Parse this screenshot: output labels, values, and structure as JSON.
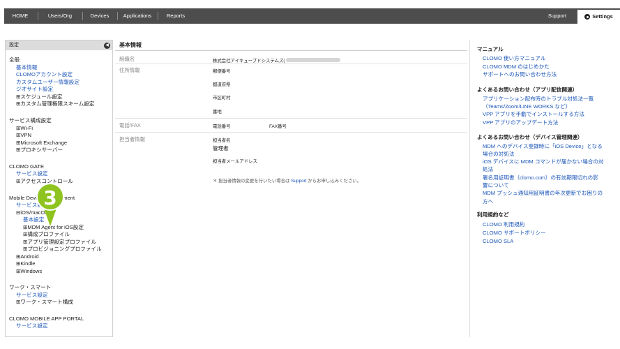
{
  "nav": {
    "items": [
      "HOME",
      "Users/Org",
      "Devices",
      "Applications",
      "Reports"
    ],
    "support": "Support",
    "settings": "Settings"
  },
  "sidebar": {
    "header": "設定",
    "collapse_icon": "chevron-left-icon",
    "lines": [
      {
        "text": "全般",
        "kind": "h"
      },
      {
        "text": "基本情報",
        "kind": "link"
      },
      {
        "text": "CLOMOアカウント設定",
        "kind": "link"
      },
      {
        "text": "カスタムユーザー情報設定",
        "kind": "link"
      },
      {
        "text": "ジオサイト設定",
        "kind": "link"
      },
      {
        "text": "⊞スケジュール設定",
        "kind": "plain"
      },
      {
        "text": "⊞カスタム管理権限スキーム設定",
        "kind": "plain"
      },
      {
        "text": "サービス構成設定",
        "kind": "h"
      },
      {
        "text": "⊞Wi-Fi",
        "kind": "plain"
      },
      {
        "text": "⊞VPN",
        "kind": "plain"
      },
      {
        "text": "⊞Microsoft Exchange",
        "kind": "plain"
      },
      {
        "text": "⊞プロキシサーバー",
        "kind": "plain"
      },
      {
        "text": "CLOMO GATE",
        "kind": "h"
      },
      {
        "text": "サービス設定",
        "kind": "link"
      },
      {
        "text": "⊞アクセスコントロール",
        "kind": "plain"
      },
      {
        "text": "Mobile Device Management",
        "kind": "h"
      },
      {
        "text": "サービス設定",
        "kind": "link"
      },
      {
        "text": "⊟iOS/macOS",
        "kind": "plain"
      },
      {
        "text": "基本設定",
        "kind": "link"
      },
      {
        "text": "⊞MDM Agent for iOS設定",
        "kind": "plain"
      },
      {
        "text": "⊞構成プロファイル",
        "kind": "plain"
      },
      {
        "text": "⊞アプリ管理設定プロファイル",
        "kind": "plain"
      },
      {
        "text": "⊞プロビジョニングプロファイル",
        "kind": "plain"
      },
      {
        "text": "⊞Android",
        "kind": "plain"
      },
      {
        "text": "⊞Kindle",
        "kind": "plain"
      },
      {
        "text": "⊞Windows",
        "kind": "plain"
      },
      {
        "text": "ワーク・スマート",
        "kind": "h"
      },
      {
        "text": "サービス設定",
        "kind": "link"
      },
      {
        "text": "⊞ワーク・スマート構成",
        "kind": "plain"
      },
      {
        "text": "CLOMO MOBILE APP PORTAL",
        "kind": "h"
      },
      {
        "text": "サービス設定",
        "kind": "link"
      }
    ]
  },
  "main": {
    "title": "基本情報",
    "org_label": "組織名",
    "org_value": "株式会社アイキューブドシステムズ(",
    "address_label": "住所情報",
    "postal": "郵便番号",
    "prefecture": "都道府県",
    "city": "市区町村",
    "street": "番地",
    "phone_label": "電話/FAX",
    "phone": "電話番号",
    "fax": "FAX番号",
    "contact_label": "担当者情報",
    "contact_name_label": "担当者名",
    "contact_name_value": "管理者",
    "contact_email_label": "担当者メールアドレス",
    "note_prefix": "＊ 担当者情報の変更を行いたい場合は",
    "note_link": "Support",
    "note_suffix": "からお申し込みください。"
  },
  "right": {
    "lines": [
      {
        "text": "マニュアル",
        "kind": "h"
      },
      {
        "text": "CLOMO 使い方マニュアル",
        "kind": "link"
      },
      {
        "text": "CLOMO MDM のはじめかた",
        "kind": "link"
      },
      {
        "text": "サポートへのお問い合わせ方法",
        "kind": "link"
      },
      {
        "text": "よくあるお問い合わせ（アプリ配信関連）",
        "kind": "h"
      },
      {
        "text": "アプリケーション配布時のトラブル対処法一覧",
        "kind": "link"
      },
      {
        "text": "（Teams/Zoom/LINE WORKS など）",
        "kind": "link"
      },
      {
        "text": "VPP アプリを手動でインストールする方法",
        "kind": "link"
      },
      {
        "text": "VPP アプリのアップデート方法",
        "kind": "link"
      },
      {
        "text": "よくあるお問い合わせ（デバイス管理関連）",
        "kind": "h"
      },
      {
        "text": "MDM へのデバイス登録時に「iOS Device」となる",
        "kind": "link"
      },
      {
        "text": "場合の対処法",
        "kind": "link"
      },
      {
        "text": "iOS デバイスに MDM コマンドが届かない場合の対",
        "kind": "link"
      },
      {
        "text": "処法",
        "kind": "link"
      },
      {
        "text": "署名用証明書（clomo.com）の有効期限切れの影",
        "kind": "link"
      },
      {
        "text": "響について",
        "kind": "link"
      },
      {
        "text": "MDM プッシュ通知用証明書の年次更新でお困りの",
        "kind": "link"
      },
      {
        "text": "方へ",
        "kind": "link"
      },
      {
        "text": "利用規約など",
        "kind": "h"
      },
      {
        "text": "CLOMO 利用規約",
        "kind": "link"
      },
      {
        "text": "CLOMO サポートポリシー",
        "kind": "link"
      },
      {
        "text": "CLOMO SLA",
        "kind": "link"
      }
    ]
  },
  "callout": {
    "number": "3",
    "color": "#8fc31f"
  }
}
